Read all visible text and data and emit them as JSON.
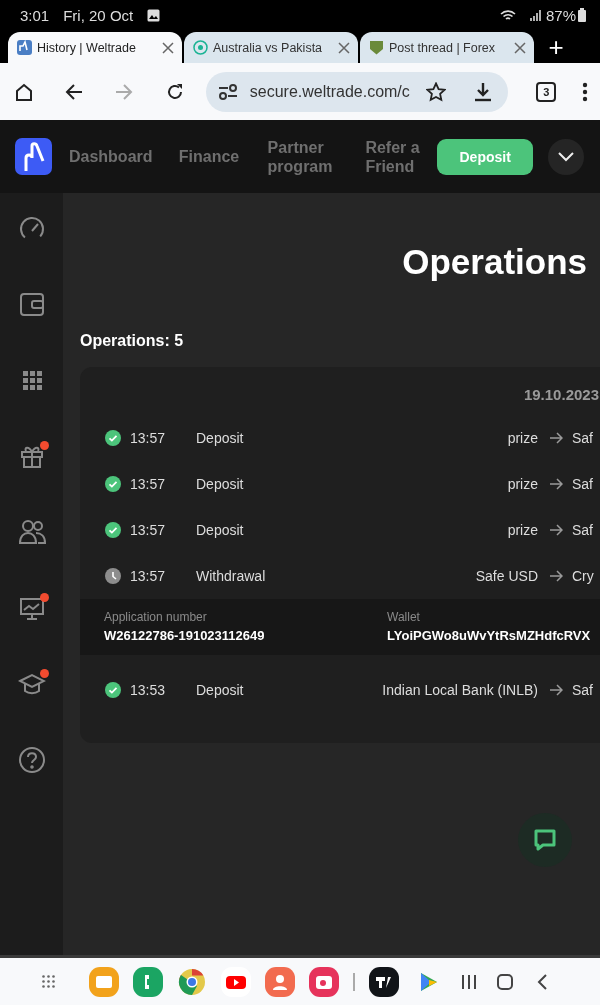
{
  "status_bar": {
    "time": "3:01",
    "date": "Fri, 20 Oct",
    "battery": "87%"
  },
  "browser_tabs": [
    {
      "title": "History | Weltrade",
      "selected": true
    },
    {
      "title": "Australia vs Pakista",
      "selected": false
    },
    {
      "title": "Post thread | Forex",
      "selected": false
    }
  ],
  "new_tab": "+",
  "toolbar": {
    "url": "secure.weltrade.com/c",
    "tab_count": "3",
    "forward_disabled": true
  },
  "header": {
    "nav": [
      {
        "label": "Dashboard"
      },
      {
        "label": "Finance"
      },
      {
        "label": "Partner program"
      },
      {
        "label": "Refer a Friend"
      }
    ],
    "deposit_button": "Deposit"
  },
  "sidebar": {
    "items": [
      {
        "notification": false
      },
      {
        "notification": false
      },
      {
        "notification": false
      },
      {
        "notification": true
      },
      {
        "notification": false
      },
      {
        "notification": true
      },
      {
        "notification": true
      },
      {
        "notification": false
      }
    ]
  },
  "page": {
    "title": "Operations",
    "count": "Operations: 5",
    "date": "19.10.2023",
    "rows": [
      {
        "kind": "operation",
        "completed": true,
        "time": "13:57",
        "type": "Deposit",
        "from": "prize",
        "to": "Saf"
      },
      {
        "kind": "operation",
        "completed": true,
        "time": "13:57",
        "type": "Deposit",
        "from": "prize",
        "to": "Saf"
      },
      {
        "kind": "operation",
        "completed": true,
        "time": "13:57",
        "type": "Deposit",
        "from": "prize",
        "to": "Saf"
      },
      {
        "kind": "operation",
        "completed": false,
        "time": "13:57",
        "type": "Withdrawal",
        "from": "Safe USD",
        "to": "Cry"
      },
      {
        "kind": "details",
        "application_label": "Application number",
        "application_number": "W26122786-191023112649",
        "wallet_label": "Wallet",
        "wallet": "LYoiPGWo8uWvYtRsMZHdfcRVX"
      },
      {
        "kind": "operation",
        "completed": true,
        "time": "13:53",
        "type": "Deposit",
        "from": "Indian Local Bank (INLB)",
        "to": "Saf"
      }
    ]
  }
}
